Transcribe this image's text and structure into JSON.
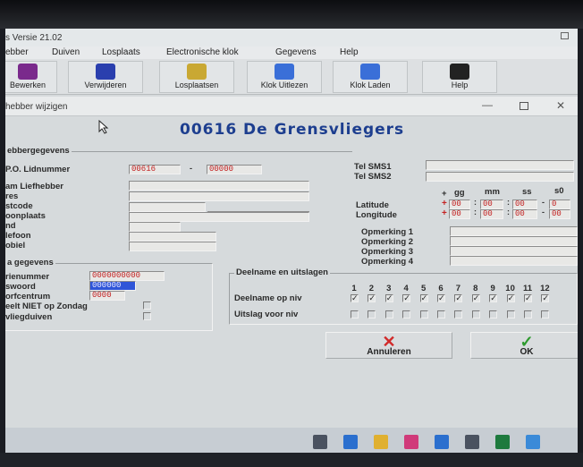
{
  "app": {
    "title": "s Versie 21.02"
  },
  "menu": [
    "ebber",
    "Duiven",
    "Losplaats",
    "Electronische klok",
    "Gegevens",
    "Help"
  ],
  "toolbar": {
    "bewerken": "Bewerken",
    "verwijderen": "Verwijderen",
    "losplaatsen": "Losplaatsen",
    "klok_uitlezen": "Klok Uitlezen",
    "klok_laden": "Klok Laden",
    "help": "Help"
  },
  "window": {
    "title": "hebber wijzigen"
  },
  "heading": "00616  De Grensvliegers",
  "section_main": "ebbergegevens",
  "fields": {
    "lidnummer_label": "P.O. Lidnummer",
    "lidnummer_value": "00616",
    "lidnummer_value2": "00000",
    "naam_label": "am Liefhebber",
    "adres_label": "res",
    "postcode_label": "stcode",
    "woonplaats_label": "oonplaats",
    "land_label": "nd",
    "telefoon_label": "lefoon",
    "mobiel_label": "obiel",
    "sms1_label": "Tel SMS1",
    "sms2_label": "Tel SMS2"
  },
  "coords": {
    "head_plus": "+",
    "head_gg": "gg",
    "head_mm": "mm",
    "head_ss": "ss",
    "head_s0": "s0",
    "latitude_label": "Latitude",
    "longitude_label": "Longitude",
    "lat": {
      "sign": "+",
      "gg": "00",
      "mm": "00",
      "ss": "00",
      "s0": "0"
    },
    "lon": {
      "sign": "+",
      "gg": "00",
      "mm": "00",
      "ss": "00",
      "s0": "00"
    }
  },
  "remarks": [
    "Opmerking 1",
    "Opmerking 2",
    "Opmerking 3",
    "Opmerking 4"
  ],
  "section_extra": "a gegevens",
  "extra": {
    "serienummer_label": "rienummer",
    "serienummer_value": "0000000000",
    "wachtwoord_label": "swoord",
    "wachtwoord_value": "000000",
    "korfcentrum_label": "orfcentrum",
    "korfcentrum_value": "0000",
    "zondag_label": "eelt NIET op Zondag",
    "vliegduiven_label": "vliegduiven"
  },
  "section_participation": "Deelname en uitslagen",
  "participation": {
    "columns": [
      "1",
      "2",
      "3",
      "4",
      "5",
      "6",
      "7",
      "8",
      "9",
      "10",
      "11",
      "12"
    ],
    "deelname_label": "Deelname op niv",
    "uitslag_label": "Uitslag voor niv",
    "deelname_checked": [
      true,
      true,
      true,
      true,
      true,
      true,
      true,
      true,
      true,
      true,
      true,
      true
    ],
    "uitslag_checked": [
      false,
      false,
      false,
      false,
      false,
      false,
      false,
      false,
      false,
      false,
      false,
      false
    ]
  },
  "buttons": {
    "annuleren": "Annuleren",
    "ok": "OK"
  }
}
